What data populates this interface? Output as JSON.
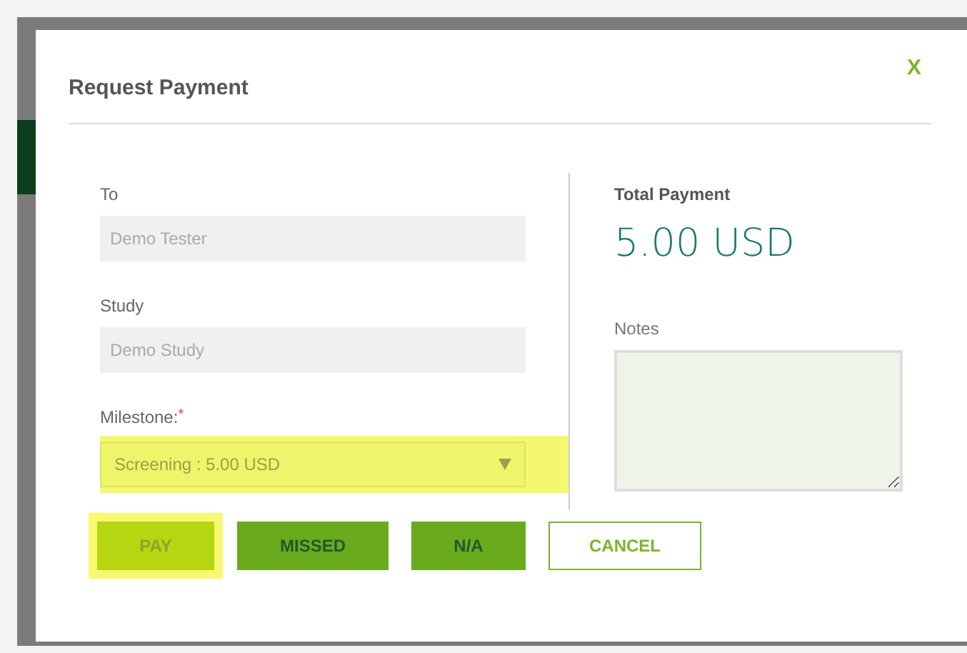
{
  "dialog": {
    "title": "Request Payment",
    "close": "X"
  },
  "fields": [
    {
      "label": "To",
      "value": "Demo Tester",
      "disabled": true
    },
    {
      "label": "Study",
      "value": "Demo Study",
      "disabled": true
    }
  ],
  "milestone": {
    "label": "Milestone:",
    "required_mark": "*",
    "value": "Screening : 5.00 USD",
    "highlighted": true
  },
  "total": {
    "label": "Total Payment",
    "amount": "5.00 USD"
  },
  "notes": {
    "label": "Notes"
  },
  "buttons": [
    {
      "label": "PAY",
      "kind": "primary",
      "disabled": true,
      "highlighted": true
    },
    {
      "label": "MISSED",
      "kind": "primary",
      "disabled": false,
      "highlighted": false
    },
    {
      "label": "N/A",
      "kind": "primary",
      "disabled": false,
      "highlighted": false
    },
    {
      "label": "CANCEL",
      "kind": "outline",
      "disabled": false,
      "highlighted": false
    }
  ]
}
